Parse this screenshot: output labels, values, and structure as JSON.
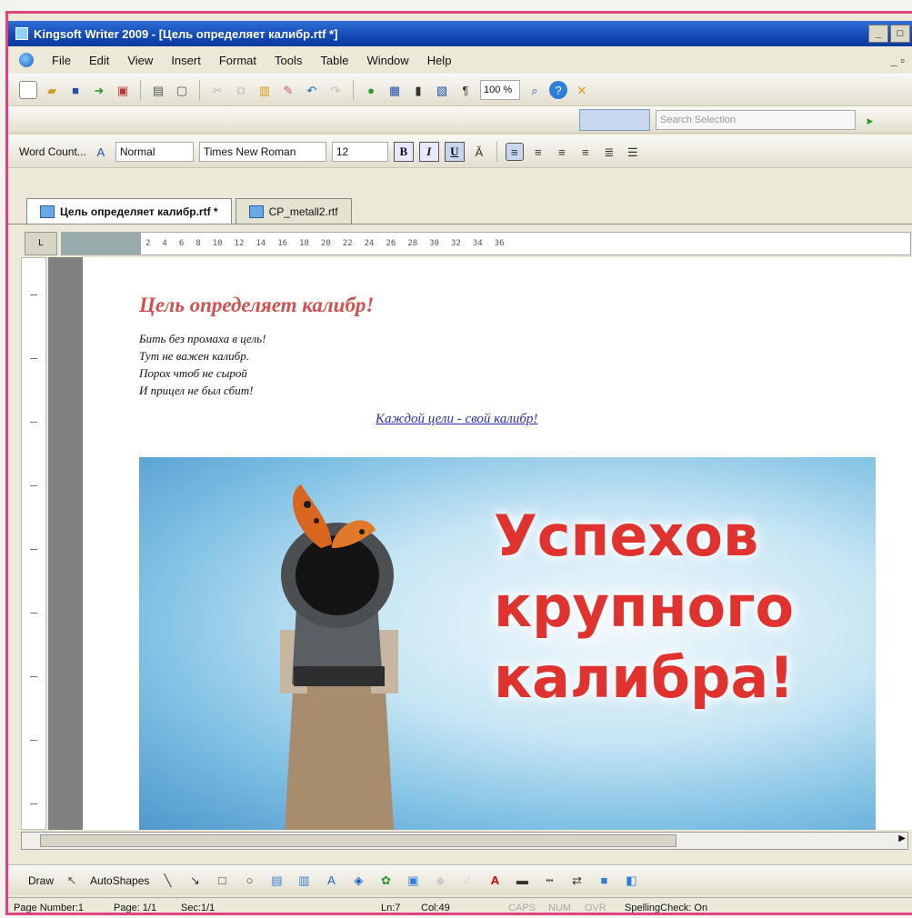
{
  "window": {
    "title": "Kingsoft Writer 2009 - [Цель определяет калибр.rtf *]",
    "min": "_",
    "max": "□",
    "close": "×"
  },
  "menubar": {
    "items": [
      "File",
      "Edit",
      "View",
      "Insert",
      "Format",
      "Tools",
      "Table",
      "Window",
      "Help"
    ],
    "controls": "_ ▫"
  },
  "toolbar": {
    "zoom": "100 %",
    "search_placeholder": "Search Selection"
  },
  "format_bar": {
    "word_count": "Word Count...",
    "style": "Normal",
    "font": "Times New Roman",
    "size": "12",
    "bold": "B",
    "italic": "I",
    "underline": "U"
  },
  "tabs": [
    {
      "label": "Цель определяет калибр.rtf *",
      "active": true
    },
    {
      "label": "CP_metall2.rtf",
      "active": false
    }
  ],
  "ruler": {
    "marks": [
      "2",
      "4",
      "6",
      "8",
      "10",
      "12",
      "14",
      "16",
      "18",
      "20",
      "22",
      "24",
      "26",
      "28",
      "30",
      "32",
      "34",
      "36"
    ]
  },
  "document": {
    "heading": "Цель определяет калибр!",
    "poem": [
      "Бить без промаха в цель!",
      "Тут не важен калибр.",
      "Порох чтоб не сырой",
      "И прицел не был сбит!"
    ],
    "link": "Каждой цели - свой калибр!",
    "banner_lines": [
      "Успехов",
      "крупного",
      "калибра!"
    ]
  },
  "drawbar": {
    "draw": "Draw",
    "autoshapes": "AutoShapes"
  },
  "statusbar": {
    "page_number": "Page Number:1",
    "page": "Page: 1/1",
    "sec": "Sec:1/1",
    "ln": "Ln:7",
    "col": "Col:49",
    "caps": "CAPS",
    "num": "NUM",
    "ovr": "OVR",
    "spell": "SpellingCheck: On"
  },
  "colors": {
    "accent_heading": "#d4504a",
    "slogan": "#e0322e",
    "link": "#2a2ab8",
    "frame": "#e0447e"
  }
}
